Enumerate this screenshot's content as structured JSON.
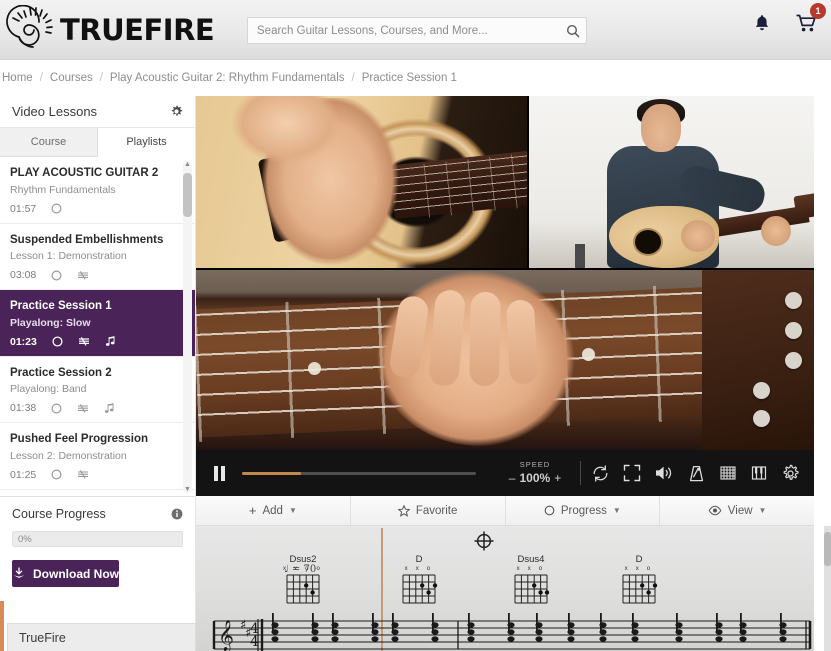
{
  "brand": {
    "name": "TRUEFIRE",
    "logo_icon": "spiral-sun-icon"
  },
  "search": {
    "placeholder": "Search Guitar Lessons, Courses, and More...",
    "value": "",
    "icon": "search-icon"
  },
  "header_icons": {
    "bell": "bell-icon",
    "cart": "shopping-cart-icon",
    "cart_count": "1"
  },
  "breadcrumb": {
    "items": [
      "Home",
      "Courses",
      "Play Acoustic Guitar 2: Rhythm Fundamentals",
      "Practice Session 1"
    ],
    "separator": "/"
  },
  "sidebar": {
    "panel_title": "Video Lessons",
    "settings_icon": "gear-icon",
    "tabs": [
      {
        "label": "Course",
        "active": false
      },
      {
        "label": "Playlists",
        "active": true
      }
    ],
    "lessons": [
      {
        "title": "PLAY ACOUSTIC GUITAR 2",
        "subtitle": "Rhythm Fundamentals",
        "time": "01:57",
        "active": false,
        "icons": [
          "progress-circle-icon"
        ]
      },
      {
        "title": "Suspended Embellishments",
        "subtitle": "Lesson 1: Demonstration",
        "time": "03:08",
        "active": false,
        "icons": [
          "progress-circle-icon",
          "tab-sheet-icon"
        ]
      },
      {
        "title": "Practice Session 1",
        "subtitle": "Playalong: Slow",
        "time": "01:23",
        "active": true,
        "icons": [
          "progress-circle-icon",
          "tab-sheet-icon",
          "music-note-icon"
        ]
      },
      {
        "title": "Practice Session 2",
        "subtitle": "Playalong: Band",
        "time": "01:38",
        "active": false,
        "icons": [
          "progress-circle-icon",
          "tab-sheet-icon",
          "music-note-icon"
        ]
      },
      {
        "title": "Pushed Feel Progression",
        "subtitle": "Lesson 2: Demonstration",
        "time": "01:25",
        "active": false,
        "icons": [
          "progress-circle-icon",
          "tab-sheet-icon"
        ]
      }
    ],
    "course_progress": {
      "label": "Course Progress",
      "info_icon": "info-icon",
      "percent_text": "0%",
      "percent_value": 0
    },
    "download_button": {
      "label": "Download Now",
      "icon": "download-icon"
    },
    "footer": {
      "label": "TrueFire"
    }
  },
  "player": {
    "play_state": "playing",
    "pause_icon": "pause-icon",
    "seek_percent": 25,
    "speed": {
      "label": "SPEED",
      "minus": "–",
      "value": "100%",
      "plus": "+"
    },
    "controls": [
      {
        "name": "loop-icon",
        "title": "Loop"
      },
      {
        "name": "fullscreen-icon",
        "title": "Fullscreen"
      },
      {
        "name": "volume-icon",
        "title": "Volume"
      },
      {
        "name": "metronome-icon",
        "title": "Metronome"
      },
      {
        "name": "tab-grid-icon",
        "title": "Tab"
      },
      {
        "name": "keyboard-icon",
        "title": "Multitrack"
      },
      {
        "name": "settings-gear-icon",
        "title": "Settings"
      }
    ],
    "views": [
      "strumming-hand-closeup",
      "full-body-shot",
      "fretboard-closeup"
    ]
  },
  "action_bar": [
    {
      "label": "Add",
      "icon": "plus-icon",
      "caret": true
    },
    {
      "label": "Favorite",
      "icon": "star-icon",
      "caret": false
    },
    {
      "label": "Progress",
      "icon": "circle-icon",
      "caret": true
    },
    {
      "label": "View",
      "icon": "eye-icon",
      "caret": true
    }
  ],
  "score": {
    "tempo_marking": "♩ = 70",
    "time_signature": "4/4",
    "key_sharps": 2,
    "clef": "treble",
    "crosshair_icon": "target-marker-icon",
    "chords": [
      {
        "name": "Dsus2",
        "frets": "x x o     o"
      },
      {
        "name": "D",
        "frets": "x x o"
      },
      {
        "name": "Dsus4",
        "frets": "x x o"
      },
      {
        "name": "D",
        "frets": "x x o"
      }
    ]
  },
  "colors": {
    "brand_purple": "#4a2458",
    "accent_orange": "#c3894a",
    "badge_red": "#b83a2c",
    "header_gray": "#e9e9e9"
  }
}
